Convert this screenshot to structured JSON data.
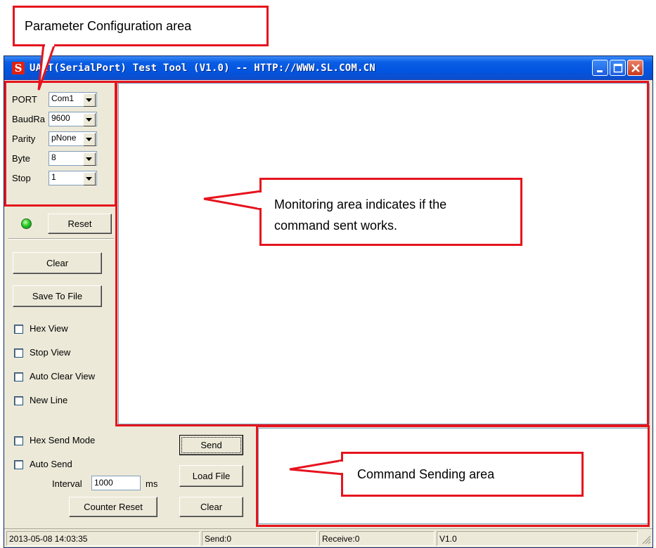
{
  "window": {
    "title": "UART(SerialPort) Test Tool (V1.0) -- HTTP://WWW.SL.COM.CN",
    "app_icon_glyph": "S",
    "controls": [
      "minimize-icon",
      "maximize-icon",
      "close-icon"
    ]
  },
  "params": [
    {
      "label": "PORT",
      "value": "Com1"
    },
    {
      "label": "BaudRa",
      "value": "9600"
    },
    {
      "label": "Parity",
      "value": "pNone"
    },
    {
      "label": "Byte",
      "value": "8"
    },
    {
      "label": "Stop",
      "value": "1"
    }
  ],
  "status_light_color": "#22cc22",
  "buttons": {
    "reset": "Reset",
    "clear": "Clear",
    "save_to_file": "Save To File",
    "send": "Send",
    "load_file": "Load File",
    "clear_send": "Clear",
    "counter_reset": "Counter Reset"
  },
  "view_options": [
    "Hex View",
    "Stop View",
    "Auto Clear View",
    "New Line"
  ],
  "send_options": {
    "hex_send_mode": "Hex Send Mode",
    "auto_send": "Auto Send",
    "interval_label": "Interval",
    "interval_value": "1000",
    "interval_unit": "ms"
  },
  "statusbar": {
    "datetime": "2013-05-08 14:03:35",
    "send": "Send:0",
    "receive": "Receive:0",
    "version": "V1.0"
  },
  "annotations": {
    "param_area": "Parameter Configuration area",
    "monitor_line1": "Monitoring area indicates if the",
    "monitor_line2": "command sent works.",
    "command_area": "Command Sending area"
  },
  "colors": {
    "annotation_red": "#e5141e",
    "titlebar_blue": "#0255e0",
    "window_face": "#ece9d8"
  }
}
